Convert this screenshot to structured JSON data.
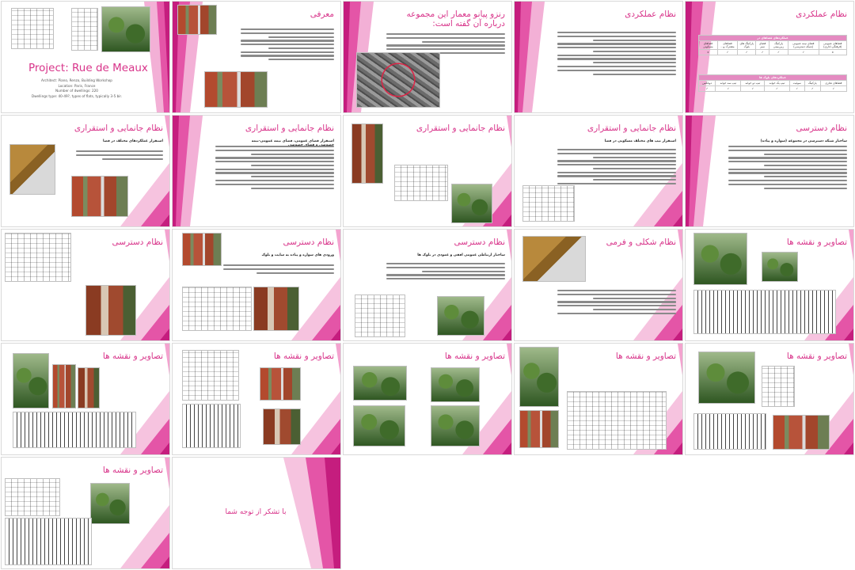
{
  "slides": [
    {
      "title": "",
      "layout": "cover",
      "project_title": "Project: Rue de Meaux",
      "info": [
        "Architect: Piano, Renzo, Building Workshop",
        "Location: Paris, France",
        "Number of dwellings: 220",
        "Dwellings type: 40-49?, types of flats, typically 3-5 bir."
      ]
    },
    {
      "title": "معرفی",
      "layout": "text-img"
    },
    {
      "title": "رنزو پیانو معمار این مجموعه درباره آن گفته است:",
      "layout": "quote-aerial"
    },
    {
      "title": "نظام عملکردی",
      "layout": "text"
    },
    {
      "title": "نظام عملکردی",
      "layout": "table",
      "table1_header": "عملکردهای فضاهای در",
      "table1_cols": [
        "فضاهای عمومی (فرهنگی-اداری)",
        "فضای نیمه عمومی (شبکه دسترسی)",
        "پارکینگ زیرزمینی",
        "فضای سبز",
        "پارکینگ های بلوک",
        "فضاهای مشترک و...",
        "فضاهای مسکونی"
      ],
      "table1_vals": [
        "x",
        "✓",
        "✓",
        "✓",
        "✓",
        "✓",
        "x"
      ],
      "table2_header": "عملکردهای بلوک ها",
      "table2_cols": [
        "فضاهای تجاری",
        "پارکینگ",
        "سوئیت",
        "تیپ یک خوابه",
        "تیپ دو خوابه",
        "تیپ سه خوابه",
        "دوبلکس"
      ],
      "table2_vals": [
        "✓",
        "✓",
        "✓",
        "✓",
        "✓",
        "✓",
        "✓"
      ]
    },
    {
      "title": "نظام جانمایی و استقراری",
      "layout": "img-text",
      "subtitle": "استقرار عملکردهای مختلف در فضا"
    },
    {
      "title": "نظام جانمایی و استقراری",
      "layout": "text",
      "subtitle": "استقرار فضای عمومی، فضای نیمه عمومی-نیمه خصوصی و فضای خصوصی"
    },
    {
      "title": "نظام جانمایی و استقراری",
      "layout": "photos"
    },
    {
      "title": "نظام جانمایی و استقراری",
      "layout": "text-plan",
      "subtitle": "استقرار تیپ های مختلف مسکونی در فضا"
    },
    {
      "title": "نظام دسترسی",
      "layout": "text",
      "subtitle": "ساختار شبکه دسترسی در مجموعه (سواره و پیاده)"
    },
    {
      "title": "نظام دسترسی",
      "layout": "plan-photo"
    },
    {
      "title": "نظام دسترسی",
      "layout": "text-imgs",
      "subtitle": "ورودی های سواره و پیاده به سایت و بلوک"
    },
    {
      "title": "نظام دسترسی",
      "layout": "text-imgs2",
      "subtitle": "ساختار ارتباطی عمومی افقی و عمودی در بلوک ها"
    },
    {
      "title": "نظام شکلی و فرمی",
      "layout": "model-text"
    },
    {
      "title": "تصاویر و نقشه ها",
      "layout": "elev"
    },
    {
      "title": "تصاویر و نقشه ها",
      "layout": "elev2"
    },
    {
      "title": "تصاویر و نقشه ها",
      "layout": "plans"
    },
    {
      "title": "تصاویر و نقشه ها",
      "layout": "greens"
    },
    {
      "title": "تصاویر و نقشه ها",
      "layout": "floor"
    },
    {
      "title": "تصاویر و نقشه ها",
      "layout": "facade"
    },
    {
      "title": "تصاویر و نقشه ها",
      "layout": "last"
    },
    {
      "title": "",
      "layout": "thanks",
      "thanks": "با تشکر از توجه شما"
    }
  ],
  "colors": {
    "accent": "#d8348a",
    "pink1": "#f3a3cf",
    "pink2": "#e455a7",
    "pink3": "#c51d7e"
  }
}
